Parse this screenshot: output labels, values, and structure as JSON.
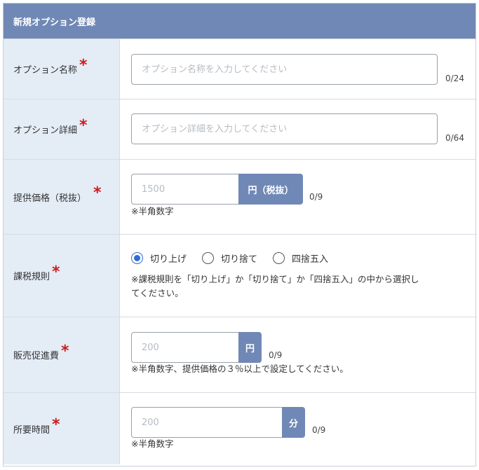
{
  "header": {
    "title": "新規オプション登録"
  },
  "required_mark": "*",
  "fields": {
    "name": {
      "label": "オプション名称",
      "placeholder": "オプション名称を入力してください",
      "counter": "0/24"
    },
    "detail": {
      "label": "オプション詳細",
      "placeholder": "オプション詳細を入力してください",
      "counter": "0/64"
    },
    "price": {
      "label": "提供価格（税抜）",
      "placeholder": "1500",
      "unit": "円（税抜）",
      "counter": "0/9",
      "note": "※半角数字"
    },
    "tax_rule": {
      "label": "課税規則",
      "options": [
        "切り上げ",
        "切り捨て",
        "四捨五入"
      ],
      "selected_index": 0,
      "note_line1": "※課税規則を「切り上げ」か「切り捨て」か「四捨五入」の中から選択し",
      "note_line2": "てください。"
    },
    "promo_fee": {
      "label": "販売促進費",
      "placeholder": "200",
      "unit": "円",
      "counter": "0/9",
      "note": "※半角数字、提供価格の３％以上で設定してください。"
    },
    "duration": {
      "label": "所要時間",
      "placeholder": "200",
      "unit": "分",
      "counter": "0/9",
      "note": "※半角数字"
    }
  },
  "colors": {
    "accent": "#7088b5",
    "label_bg": "#e4edf6",
    "required": "#cc1d1d",
    "radio": "#2f6cd6"
  }
}
